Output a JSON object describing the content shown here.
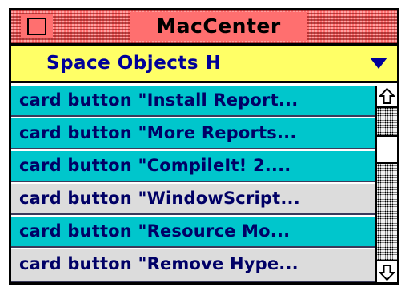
{
  "window": {
    "title": "MacCenter"
  },
  "popup": {
    "selected": "Space Objects H"
  },
  "list": {
    "items": [
      {
        "label": "card button \"Install Report...",
        "style": "cyan"
      },
      {
        "label": "card button \"More Reports...",
        "style": "cyan"
      },
      {
        "label": "card button \"CompileIt! 2....",
        "style": "cyan"
      },
      {
        "label": "card button \"WindowScript...",
        "style": "grey"
      },
      {
        "label": "card button \"Resource Mo...",
        "style": "cyan"
      },
      {
        "label": "card button \"Remove Hype...",
        "style": "grey"
      }
    ]
  },
  "colors": {
    "title_bar": "#ff6f6f",
    "popup_background": "#ffff66",
    "popup_text": "#000099",
    "row_cyan": "#00c6cc",
    "row_grey": "#dcdcdc",
    "row_text": "#000066"
  },
  "icons": {
    "close": "close-box-icon",
    "popup_arrow": "triangle-down-icon",
    "scroll_up": "arrow-up-icon",
    "scroll_down": "arrow-down-icon"
  }
}
